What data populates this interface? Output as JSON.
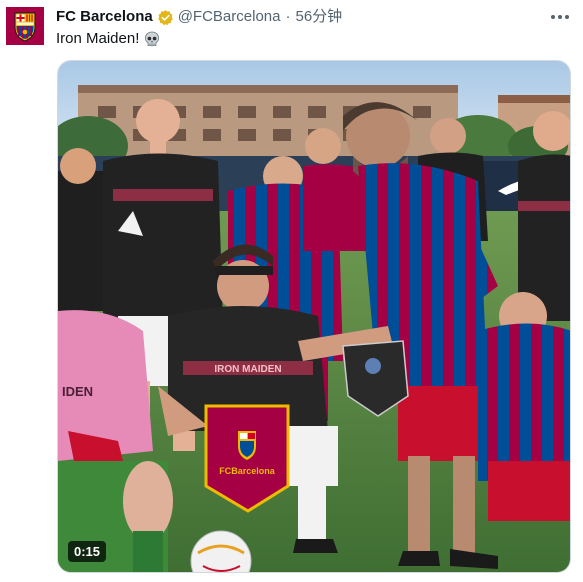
{
  "tweet": {
    "display_name": "FC Barcelona",
    "handle": "@FCBarcelona",
    "separator": "·",
    "timestamp": "56分钟",
    "text": "Iron Maiden!",
    "emoji_icon": "skull-icon"
  },
  "media": {
    "type": "video",
    "duration": "0:15",
    "pennant_text": "FCBarcelona",
    "shirt_text": "IRON MAIDEN",
    "keeper_shirt_text": "IDEN"
  },
  "colors": {
    "brand_blue": "#004d98",
    "brand_garnet": "#a50044",
    "verified_gold": "#e2b719"
  },
  "icons": [
    "fcb-crest-icon",
    "verified-badge-icon",
    "more-options-icon",
    "skull-icon"
  ]
}
